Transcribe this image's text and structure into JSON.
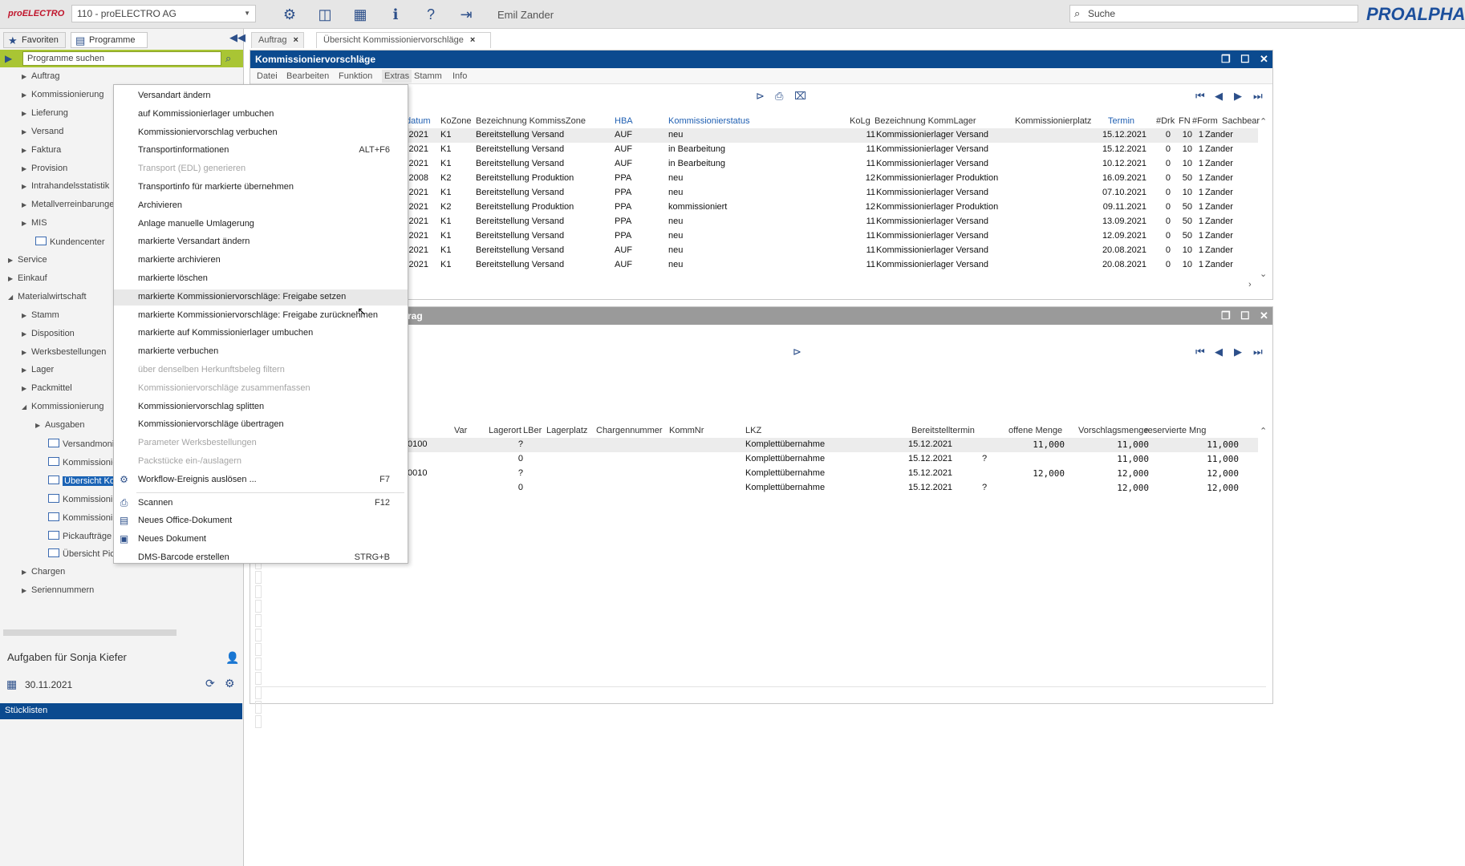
{
  "topbar": {
    "logo": "proELECTRO",
    "company": "110 - proELECTRO AG",
    "user": "Emil Zander",
    "search_placeholder": "Suche",
    "brand": "PROALPHA"
  },
  "left": {
    "tab_favoriten": "Favoriten",
    "tab_programme": "Programme",
    "search_placeholder": "Programme suchen",
    "tree": [
      {
        "label": "Auftrag",
        "level": 1
      },
      {
        "label": "Kommissionierung",
        "level": 1
      },
      {
        "label": "Lieferung",
        "level": 1
      },
      {
        "label": "Versand",
        "level": 1
      },
      {
        "label": "Faktura",
        "level": 1
      },
      {
        "label": "Provision",
        "level": 1
      },
      {
        "label": "Intrahandelsstatistik",
        "level": 1
      },
      {
        "label": "Metallverreinbarungen",
        "level": 1
      },
      {
        "label": "MIS",
        "level": 1
      },
      {
        "label": "Kundencenter",
        "level": 2
      },
      {
        "label": "Service",
        "level": 0
      },
      {
        "label": "Einkauf",
        "level": 0
      },
      {
        "label": "Materialwirtschaft",
        "level": 0
      },
      {
        "label": "Stamm",
        "level": 1
      },
      {
        "label": "Disposition",
        "level": 1
      },
      {
        "label": "Werksbestellungen",
        "level": 1
      },
      {
        "label": "Lager",
        "level": 1
      },
      {
        "label": "Packmittel",
        "level": 1
      },
      {
        "label": "Kommissionierung",
        "level": 1
      },
      {
        "label": "Ausgaben",
        "level": 2
      },
      {
        "label": "Versandmoni",
        "level": 3
      },
      {
        "label": "Kommissionie",
        "level": 3
      },
      {
        "label": "Übersicht Ko",
        "level": 3
      },
      {
        "label": "Kommissioni",
        "level": 3
      },
      {
        "label": "Kommissioni",
        "level": 3
      },
      {
        "label": "Pickaufträge",
        "level": 3
      },
      {
        "label": "Übersicht Pic",
        "level": 3
      },
      {
        "label": "Chargen",
        "level": 1
      },
      {
        "label": "Seriennummern",
        "level": 1
      }
    ],
    "tasks_title": "Aufgaben für Sonja Kiefer",
    "tasks_date": "30.11.2021",
    "task_row": "Stücklisten"
  },
  "doc_tabs": [
    {
      "label": "Auftrag"
    },
    {
      "label": "Übersicht Kommissioniervorschläge"
    }
  ],
  "window1": {
    "title": "Kommissioniervorschläge",
    "menu": [
      "Datei",
      "Bearbeiten",
      "Funktion",
      "Extras",
      "Stamm",
      "Info"
    ],
    "headers": [
      "datum",
      "KoZone",
      "Bezeichnung KommissZone",
      "HBA",
      "Kommissionierstatus",
      "KoLg",
      "Bezeichnung KommLager",
      "Kommissionierplatz",
      "Termin",
      "#Drk",
      "FN",
      "#Form",
      "Sachbear"
    ],
    "rows": [
      [
        "2021",
        "K1",
        "Bereitstellung Versand",
        "AUF",
        "neu",
        "11",
        "Kommissionierlager Versand",
        "15.12.2021",
        "0",
        "10",
        "1",
        "Zander"
      ],
      [
        "2021",
        "K1",
        "Bereitstellung Versand",
        "AUF",
        "in Bearbeitung",
        "11",
        "Kommissionierlager Versand",
        "15.12.2021",
        "0",
        "10",
        "1",
        "Zander"
      ],
      [
        "2021",
        "K1",
        "Bereitstellung Versand",
        "AUF",
        "in Bearbeitung",
        "11",
        "Kommissionierlager Versand",
        "10.12.2021",
        "0",
        "10",
        "1",
        "Zander"
      ],
      [
        "2008",
        "K2",
        "Bereitstellung Produktion",
        "PPA",
        "neu",
        "12",
        "Kommissionierlager Produktion",
        "16.09.2021",
        "0",
        "50",
        "1",
        "Zander"
      ],
      [
        "2021",
        "K1",
        "Bereitstellung Versand",
        "PPA",
        "neu",
        "11",
        "Kommissionierlager Versand",
        "07.10.2021",
        "0",
        "10",
        "1",
        "Zander"
      ],
      [
        "2021",
        "K2",
        "Bereitstellung Produktion",
        "PPA",
        "kommissioniert",
        "12",
        "Kommissionierlager Produktion",
        "09.11.2021",
        "0",
        "50",
        "1",
        "Zander"
      ],
      [
        "2021",
        "K1",
        "Bereitstellung Versand",
        "PPA",
        "neu",
        "11",
        "Kommissionierlager Versand",
        "13.09.2021",
        "0",
        "50",
        "1",
        "Zander"
      ],
      [
        "2021",
        "K1",
        "Bereitstellung Versand",
        "PPA",
        "neu",
        "11",
        "Kommissionierlager Versand",
        "12.09.2021",
        "0",
        "50",
        "1",
        "Zander"
      ],
      [
        "2021",
        "K1",
        "Bereitstellung Versand",
        "AUF",
        "neu",
        "11",
        "Kommissionierlager Versand",
        "20.08.2021",
        "0",
        "10",
        "1",
        "Zander"
      ],
      [
        "2021",
        "K1",
        "Bereitstellung Versand",
        "AUF",
        "neu",
        "11",
        "Kommissionierlager Versand",
        "20.08.2021",
        "0",
        "10",
        "1",
        "Zander"
      ]
    ]
  },
  "window2": {
    "title_partial": "rag",
    "headers": [
      "Var",
      "Lagerort",
      "LBer",
      "Lagerplatz",
      "Chargennummer",
      "KommNr",
      "LKZ",
      "Bereitstelltermin",
      "offene Menge",
      "Vorschlagsmenge",
      "reservierte Mng"
    ],
    "rows": [
      [
        "0100",
        "?",
        "Komplettübernahme",
        "15.12.2021",
        "",
        "11,000",
        "11,000",
        "11,000"
      ],
      [
        "",
        "0",
        "Komplettübernahme",
        "15.12.2021",
        "?",
        "",
        "11,000",
        "11,000"
      ],
      [
        "0010",
        "?",
        "Komplettübernahme",
        "15.12.2021",
        "",
        "12,000",
        "12,000",
        "12,000"
      ],
      [
        "",
        "0",
        "Komplettübernahme",
        "15.12.2021",
        "?",
        "",
        "12,000",
        "12,000"
      ]
    ]
  },
  "context_menu": [
    {
      "label": "Versandart ändern",
      "shortcut": "",
      "disabled": false
    },
    {
      "label": "auf Kommissionierlager umbuchen",
      "shortcut": "",
      "disabled": false
    },
    {
      "label": "Kommissioniervorschlag verbuchen",
      "shortcut": "",
      "disabled": false
    },
    {
      "label": "Transportinformationen",
      "shortcut": "ALT+F6",
      "disabled": false
    },
    {
      "label": "Transport (EDL) generieren",
      "shortcut": "",
      "disabled": true
    },
    {
      "label": "Transportinfo für markierte übernehmen",
      "shortcut": "",
      "disabled": false
    },
    {
      "label": "Archivieren",
      "shortcut": "",
      "disabled": false
    },
    {
      "label": "Anlage manuelle Umlagerung",
      "shortcut": "",
      "disabled": false
    },
    {
      "label": "markierte Versandart ändern",
      "shortcut": "",
      "disabled": false
    },
    {
      "label": "markierte archivieren",
      "shortcut": "",
      "disabled": false
    },
    {
      "label": "markierte löschen",
      "shortcut": "",
      "disabled": false
    },
    {
      "label": "markierte Kommissioniervorschläge: Freigabe setzen",
      "shortcut": "",
      "disabled": false,
      "highlight": true
    },
    {
      "label": "markierte Kommissioniervorschläge: Freigabe zurücknehmen",
      "shortcut": "",
      "disabled": false
    },
    {
      "label": "markierte auf Kommissionierlager umbuchen",
      "shortcut": "",
      "disabled": false
    },
    {
      "label": "markierte verbuchen",
      "shortcut": "",
      "disabled": false
    },
    {
      "label": "über denselben Herkunftsbeleg filtern",
      "shortcut": "",
      "disabled": true
    },
    {
      "label": "Kommissioniervorschläge zusammenfassen",
      "shortcut": "",
      "disabled": true
    },
    {
      "label": "Kommissioniervorschlag splitten",
      "shortcut": "",
      "disabled": false
    },
    {
      "label": "Kommissioniervorschläge übertragen",
      "shortcut": "",
      "disabled": false
    },
    {
      "label": "Parameter Werksbestellungen",
      "shortcut": "",
      "disabled": true
    },
    {
      "label": "Packstücke ein-/auslagern",
      "shortcut": "",
      "disabled": true
    },
    {
      "label": "Workflow-Ereignis auslösen ...",
      "shortcut": "F7",
      "disabled": false
    },
    {
      "label": "Scannen",
      "shortcut": "F12",
      "disabled": false
    },
    {
      "label": "Neues Office-Dokument",
      "shortcut": "",
      "disabled": false
    },
    {
      "label": "Neues Dokument",
      "shortcut": "",
      "disabled": false
    },
    {
      "label": "DMS-Barcode erstellen",
      "shortcut": "STRG+B",
      "disabled": false
    }
  ],
  "colors": {
    "title_blue": "#0b4a8f",
    "title_gray": "#9a9a9a",
    "accent_green": "#a9c534",
    "link_blue": "#1f5fb2"
  }
}
